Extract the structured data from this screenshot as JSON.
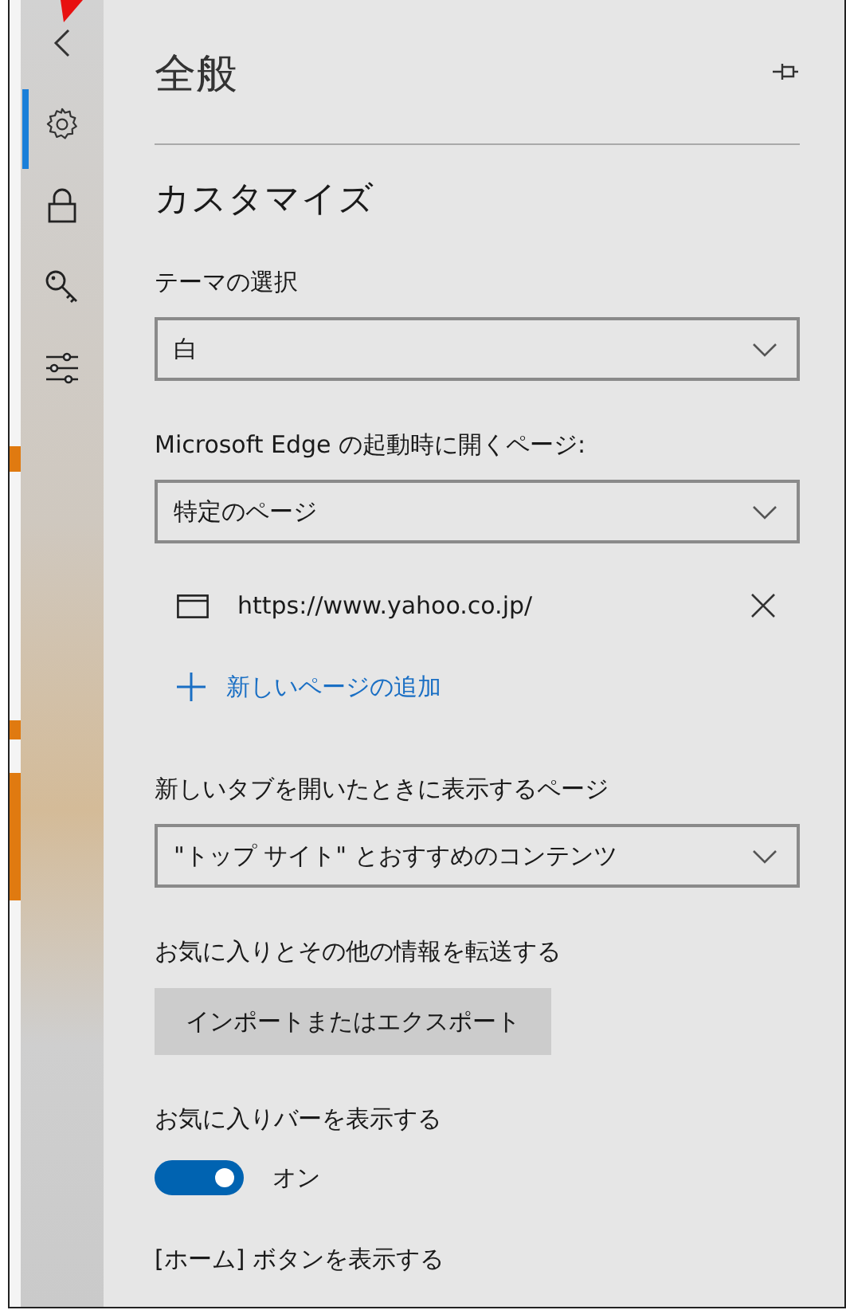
{
  "sidebar": {
    "items": [
      {
        "kind": "back",
        "selected": false
      },
      {
        "kind": "settings",
        "selected": true
      },
      {
        "kind": "lock",
        "selected": false
      },
      {
        "kind": "key",
        "selected": false
      },
      {
        "kind": "sliders",
        "selected": false
      }
    ]
  },
  "panel": {
    "title": "全般",
    "section_title": "カスタマイズ"
  },
  "settings": [
    {
      "kind": "dropdown",
      "label": "テーマの選択",
      "value": "白"
    },
    {
      "kind": "dropdown",
      "label": "Microsoft Edge の起動時に開くページ:",
      "value": "特定のページ"
    },
    {
      "kind": "page",
      "url": "https://www.yahoo.co.jp/"
    },
    {
      "kind": "add",
      "text": "新しいページの追加"
    },
    {
      "kind": "dropdown",
      "label": "新しいタブを開いたときに表示するページ",
      "value": "\"トップ サイト\" とおすすめのコンテンツ"
    },
    {
      "kind": "button",
      "label": "お気に入りとその他の情報を転送する",
      "text": "インポートまたはエクスポート"
    },
    {
      "kind": "toggle",
      "label": "お気に入りバーを表示する",
      "on": true,
      "text": "オン"
    },
    {
      "kind": "label",
      "label": "[ホーム] ボタンを表示する"
    }
  ]
}
